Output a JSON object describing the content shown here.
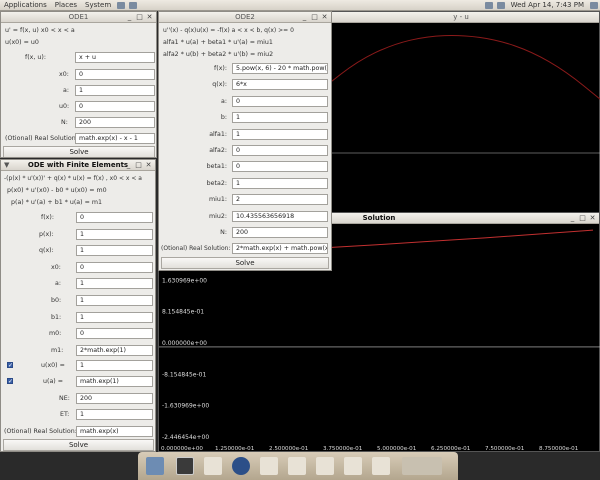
{
  "topbar": {
    "applications": "Applications",
    "places": "Places",
    "system": "System",
    "clock": "Wed Apr 14,  7:43 PM"
  },
  "ode1": {
    "title": "ODE1",
    "eq1": "u' = f(x, u)   x0 < x < a",
    "eq2": "u(x0) = u0",
    "f_label": "f(x, u):",
    "f_value": "x + u",
    "x0_label": "x0:",
    "x0_value": "0",
    "a_label": "a:",
    "a_value": "1",
    "u0_label": "u0:",
    "u0_value": "0",
    "N_label": "N:",
    "N_value": "200",
    "real_label": "(Otional) Real Solution:",
    "real_value": "math.exp(x) - x - 1",
    "solve": "Solve"
  },
  "fe": {
    "title": "ODE with Finite Elements",
    "eq1": "-(p(x) * u'(x))' + q(x) * u(x) = f(x)    , x0 < x < a",
    "eq2": "p(x0) * u'(x0) - b0 * u(x0) = m0",
    "eq3": "p(a) * u'(a) + b1 * u(a) = m1",
    "rows": [
      {
        "label": "f(x):",
        "value": "0"
      },
      {
        "label": "p(x):",
        "value": "1"
      },
      {
        "label": "q(x):",
        "value": "1"
      },
      {
        "label": "x0:",
        "value": "0"
      },
      {
        "label": "a:",
        "value": "1"
      },
      {
        "label": "b0:",
        "value": "1"
      },
      {
        "label": "b1:",
        "value": "1"
      },
      {
        "label": "m0:",
        "value": "0"
      },
      {
        "label": "m1:",
        "value": "2*math.exp(1)"
      }
    ],
    "ux0_label": "u(x0) =",
    "ux0_value": "1",
    "ua_label": "u(a) =",
    "ua_value": "math.exp(1)",
    "NE_label": "NE:",
    "NE_value": "200",
    "ET_label": "ET:",
    "ET_value": "1",
    "real_label": "(Otional) Real Solution:",
    "real_value": "math.exp(x)",
    "solve": "Solve"
  },
  "ode2": {
    "title": "ODE2",
    "eq1": "u''(x) - q(x)u(x) = -f(x)            a < x < b, q(x) >= 0",
    "eq2": "alfa1 * u(a) + beta1 * u'(a) = miu1",
    "eq3": "alfa2 * u(b) + beta2 * u'(b) = miu2",
    "rows": [
      {
        "label": "f(x):",
        "value": "5.pow(x, 6) - 20 * math.pow(x, 3)"
      },
      {
        "label": "q(x):",
        "value": "6*x"
      },
      {
        "label": "a:",
        "value": "0"
      },
      {
        "label": "b:",
        "value": "1"
      },
      {
        "label": "alfa1:",
        "value": "1"
      },
      {
        "label": "alfa2:",
        "value": "0"
      },
      {
        "label": "beta1:",
        "value": "0"
      },
      {
        "label": "beta2:",
        "value": "1"
      },
      {
        "label": "miu1:",
        "value": "2"
      },
      {
        "label": "miu2:",
        "value": "10.435563656918"
      },
      {
        "label": "N:",
        "value": "200"
      }
    ],
    "real_label": "(Otional) Real Solution:",
    "real_value": "2*math.exp(x) + math.pow(x, 5)",
    "solve": "Solve"
  },
  "plot1": {
    "title": "y - u"
  },
  "plot2": {
    "title": "Solution"
  },
  "chart_data": [
    {
      "type": "line",
      "title": "y - u",
      "series": [
        {
          "color": "#8b1a1a",
          "x": [
            0,
            0.125,
            0.25,
            0.375,
            0.5,
            0.625,
            0.75,
            0.875,
            1
          ],
          "y": [
            0.55,
            0.78,
            0.92,
            0.99,
            1.0,
            0.96,
            0.86,
            0.69,
            0.45
          ]
        }
      ]
    },
    {
      "type": "line",
      "title": "Solution",
      "y_ticks": [
        "1.630969e+00",
        "8.154845e-01",
        "0.000000e+00",
        "-8.154845e-01",
        "-1.630969e+00",
        "-2.446454e+00"
      ],
      "x_ticks": [
        "0.000000e+00",
        "1.250000e-01",
        "2.500000e-01",
        "3.750000e-01",
        "5.000000e-01",
        "6.250000e-01",
        "7.500000e-01",
        "8.750000e-01"
      ],
      "ylim": [
        -2.446454,
        3.2
      ],
      "xlim": [
        0,
        1
      ],
      "series": [
        {
          "color": "#c23030",
          "x": [
            0,
            0.125,
            0.25,
            0.375,
            0.5,
            0.625,
            0.75,
            0.875,
            1
          ],
          "y": [
            2.34,
            2.42,
            2.5,
            2.58,
            2.66,
            2.75,
            2.84,
            2.94,
            3.04
          ]
        }
      ]
    }
  ]
}
